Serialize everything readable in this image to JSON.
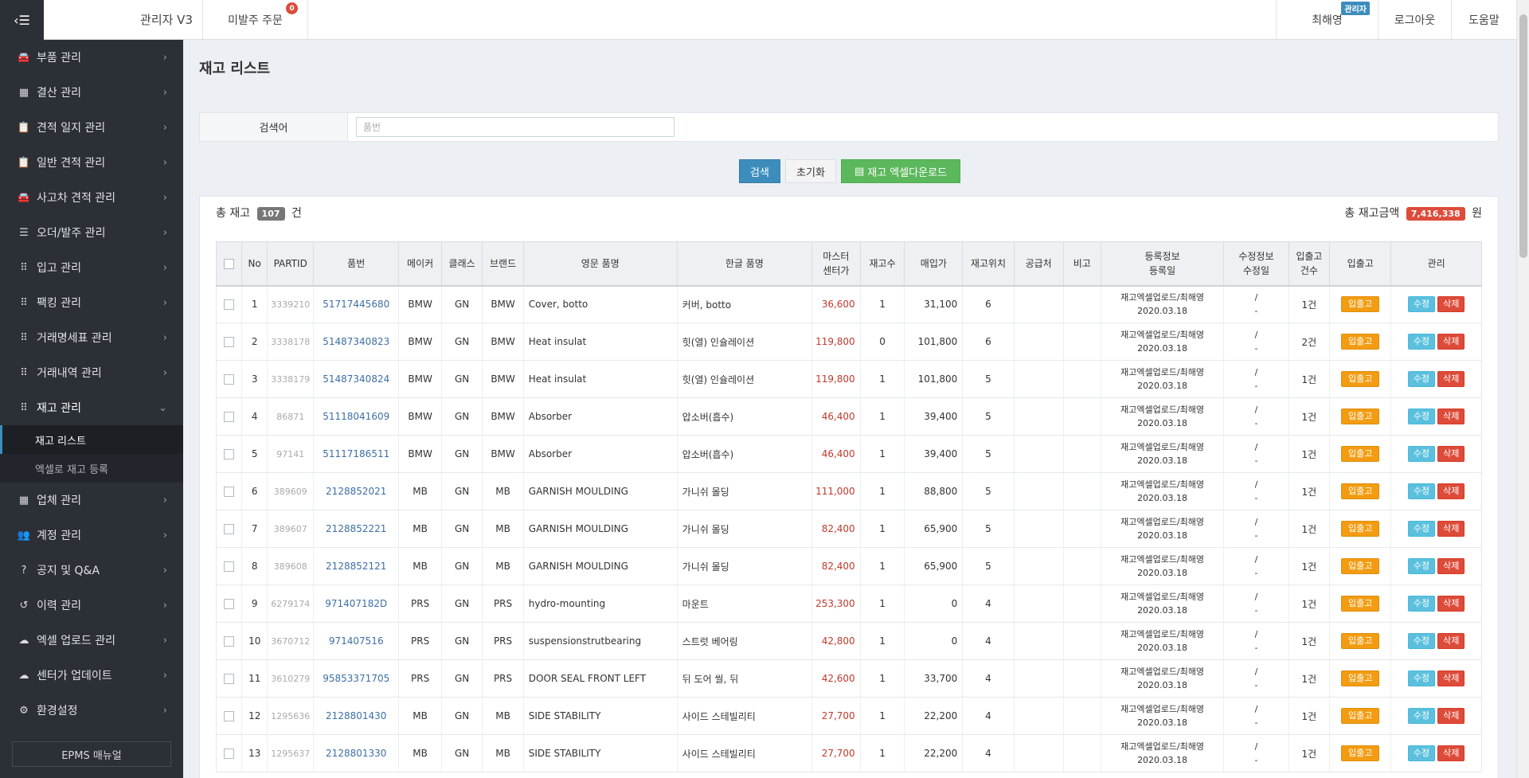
{
  "header": {
    "brand": "관리자 V3",
    "pending_orders_label": "미발주 주문",
    "pending_orders_count": "0",
    "user_name": "최해영",
    "user_role": "관리자",
    "logout": "로그아웃",
    "help": "도움말"
  },
  "sidebar": {
    "items": [
      {
        "label": "부품 관리",
        "icon": "car-icon"
      },
      {
        "label": "결산 관리",
        "icon": "calculator-icon"
      },
      {
        "label": "견적 일지 관리",
        "icon": "clipboard-icon"
      },
      {
        "label": "일반 견적 관리",
        "icon": "clipboard-icon"
      },
      {
        "label": "사고차 견적 관리",
        "icon": "car-icon"
      },
      {
        "label": "오더/발주 관리",
        "icon": "list-icon"
      },
      {
        "label": "입고 관리",
        "icon": "grid-icon"
      },
      {
        "label": "팩킹 관리",
        "icon": "grid-icon"
      },
      {
        "label": "거래명세표 관리",
        "icon": "grid-icon"
      },
      {
        "label": "거래내역 관리",
        "icon": "grid-icon"
      },
      {
        "label": "재고 관리",
        "icon": "grid-icon"
      }
    ],
    "sub_items": [
      {
        "label": "재고 리스트"
      },
      {
        "label": "엑셀로 재고 등록"
      }
    ],
    "items_after": [
      {
        "label": "업체 관리",
        "icon": "building-icon"
      },
      {
        "label": "계정 관리",
        "icon": "users-icon"
      },
      {
        "label": "공지 및 Q&A",
        "icon": "question-icon"
      },
      {
        "label": "이력 관리",
        "icon": "history-icon"
      },
      {
        "label": "엑셀 업로드 관리",
        "icon": "cloud-upload-icon"
      },
      {
        "label": "센터가 업데이트",
        "icon": "cloud-upload-icon"
      },
      {
        "label": "환경설정",
        "icon": "gear-icon"
      }
    ],
    "manual": "EPMS 매뉴얼"
  },
  "page": {
    "title": "재고 리스트",
    "search_label": "검색어",
    "search_placeholder": "품번",
    "btn_search": "검색",
    "btn_reset": "초기화",
    "btn_excel": "재고 엑셀다운로드",
    "total_label": "총 재고",
    "total_count": "107",
    "total_unit": "건",
    "amount_label": "총 재고금액",
    "amount_value": "7,416,338",
    "amount_unit": "원"
  },
  "table": {
    "headers": [
      "No",
      "PARTID",
      "품번",
      "메이커",
      "클래스",
      "브랜드",
      "영문 품명",
      "한글 품명",
      "마스터\n센터가",
      "재고수",
      "매입가",
      "재고위치",
      "공급처",
      "비고",
      "등록정보\n등록일",
      "수정정보\n수정일",
      "입출고\n건수",
      "입출고",
      "관리"
    ],
    "btn_io": "입출고",
    "btn_edit": "수정",
    "btn_delete": "삭제",
    "rows": [
      {
        "no": "1",
        "partid": "3339210",
        "partno": "51717445680",
        "maker": "BMW",
        "cls": "GN",
        "brand": "BMW",
        "en": "Cover, botto",
        "ko": "커버, botto",
        "center": "36,600",
        "qty": "1",
        "buy": "31,100",
        "loc": "6",
        "supplier": "",
        "note": "",
        "reg1": "재고엑셀업로드/최해영",
        "reg2": "2020.03.18",
        "mod1": "/",
        "mod2": "-",
        "io": "1건"
      },
      {
        "no": "2",
        "partid": "3338178",
        "partno": "51487340823",
        "maker": "BMW",
        "cls": "GN",
        "brand": "BMW",
        "en": "Heat insulat",
        "ko": "힛(열) 인슐레이션",
        "center": "119,800",
        "qty": "0",
        "buy": "101,800",
        "loc": "6",
        "supplier": "",
        "note": "",
        "reg1": "재고엑셀업로드/최해영",
        "reg2": "2020.03.18",
        "mod1": "/",
        "mod2": "-",
        "io": "2건"
      },
      {
        "no": "3",
        "partid": "3338179",
        "partno": "51487340824",
        "maker": "BMW",
        "cls": "GN",
        "brand": "BMW",
        "en": "Heat insulat",
        "ko": "힛(열) 인슐레이션",
        "center": "119,800",
        "qty": "1",
        "buy": "101,800",
        "loc": "5",
        "supplier": "",
        "note": "",
        "reg1": "재고엑셀업로드/최해영",
        "reg2": "2020.03.18",
        "mod1": "/",
        "mod2": "-",
        "io": "1건"
      },
      {
        "no": "4",
        "partid": "86871",
        "partno": "51118041609",
        "maker": "BMW",
        "cls": "GN",
        "brand": "BMW",
        "en": "Absorber",
        "ko": "압소버(흡수)",
        "center": "46,400",
        "qty": "1",
        "buy": "39,400",
        "loc": "5",
        "supplier": "",
        "note": "",
        "reg1": "재고엑셀업로드/최해영",
        "reg2": "2020.03.18",
        "mod1": "/",
        "mod2": "-",
        "io": "1건"
      },
      {
        "no": "5",
        "partid": "97141",
        "partno": "51117186511",
        "maker": "BMW",
        "cls": "GN",
        "brand": "BMW",
        "en": "Absorber",
        "ko": "압소버(흡수)",
        "center": "46,400",
        "qty": "1",
        "buy": "39,400",
        "loc": "5",
        "supplier": "",
        "note": "",
        "reg1": "재고엑셀업로드/최해영",
        "reg2": "2020.03.18",
        "mod1": "/",
        "mod2": "-",
        "io": "1건"
      },
      {
        "no": "6",
        "partid": "389609",
        "partno": "2128852021",
        "maker": "MB",
        "cls": "GN",
        "brand": "MB",
        "en": "GARNISH MOULDING",
        "ko": "가니쉬 몰딩",
        "center": "111,000",
        "qty": "1",
        "buy": "88,800",
        "loc": "5",
        "supplier": "",
        "note": "",
        "reg1": "재고엑셀업로드/최해영",
        "reg2": "2020.03.18",
        "mod1": "/",
        "mod2": "-",
        "io": "1건"
      },
      {
        "no": "7",
        "partid": "389607",
        "partno": "2128852221",
        "maker": "MB",
        "cls": "GN",
        "brand": "MB",
        "en": "GARNISH MOULDING",
        "ko": "가니쉬 몰딩",
        "center": "82,400",
        "qty": "1",
        "buy": "65,900",
        "loc": "5",
        "supplier": "",
        "note": "",
        "reg1": "재고엑셀업로드/최해영",
        "reg2": "2020.03.18",
        "mod1": "/",
        "mod2": "-",
        "io": "1건"
      },
      {
        "no": "8",
        "partid": "389608",
        "partno": "2128852121",
        "maker": "MB",
        "cls": "GN",
        "brand": "MB",
        "en": "GARNISH MOULDING",
        "ko": "가니쉬 몰딩",
        "center": "82,400",
        "qty": "1",
        "buy": "65,900",
        "loc": "5",
        "supplier": "",
        "note": "",
        "reg1": "재고엑셀업로드/최해영",
        "reg2": "2020.03.18",
        "mod1": "/",
        "mod2": "-",
        "io": "1건"
      },
      {
        "no": "9",
        "partid": "6279174",
        "partno": "971407182D",
        "maker": "PRS",
        "cls": "GN",
        "brand": "PRS",
        "en": "hydro-mounting",
        "ko": "마운트",
        "center": "253,300",
        "qty": "1",
        "buy": "0",
        "loc": "4",
        "supplier": "",
        "note": "",
        "reg1": "재고엑셀업로드/최해영",
        "reg2": "2020.03.18",
        "mod1": "/",
        "mod2": "-",
        "io": "1건"
      },
      {
        "no": "10",
        "partid": "3670712",
        "partno": "971407516",
        "maker": "PRS",
        "cls": "GN",
        "brand": "PRS",
        "en": "suspensionstrutbearing",
        "ko": "스트럿 베어링",
        "center": "42,800",
        "qty": "1",
        "buy": "0",
        "loc": "4",
        "supplier": "",
        "note": "",
        "reg1": "재고엑셀업로드/최해영",
        "reg2": "2020.03.18",
        "mod1": "/",
        "mod2": "-",
        "io": "1건"
      },
      {
        "no": "11",
        "partid": "3610279",
        "partno": "95853371705",
        "maker": "PRS",
        "cls": "GN",
        "brand": "PRS",
        "en": "DOOR SEAL FRONT LEFT",
        "ko": "뒤 도어 씰, 뒤",
        "center": "42,600",
        "qty": "1",
        "buy": "33,700",
        "loc": "4",
        "supplier": "",
        "note": "",
        "reg1": "재고엑셀업로드/최해영",
        "reg2": "2020.03.18",
        "mod1": "/",
        "mod2": "-",
        "io": "1건"
      },
      {
        "no": "12",
        "partid": "1295636",
        "partno": "2128801430",
        "maker": "MB",
        "cls": "GN",
        "brand": "MB",
        "en": "SIDE STABILITY",
        "ko": "사이드 스테빌리티",
        "center": "27,700",
        "qty": "1",
        "buy": "22,200",
        "loc": "4",
        "supplier": "",
        "note": "",
        "reg1": "재고엑셀업로드/최해영",
        "reg2": "2020.03.18",
        "mod1": "/",
        "mod2": "-",
        "io": "1건"
      },
      {
        "no": "13",
        "partid": "1295637",
        "partno": "2128801330",
        "maker": "MB",
        "cls": "GN",
        "brand": "MB",
        "en": "SIDE STABILITY",
        "ko": "사이드 스테빌리티",
        "center": "27,700",
        "qty": "1",
        "buy": "22,200",
        "loc": "4",
        "supplier": "",
        "note": "",
        "reg1": "재고엑셀업로드/최해영",
        "reg2": "2020.03.18",
        "mod1": "/",
        "mod2": "-",
        "io": "1건"
      }
    ]
  }
}
